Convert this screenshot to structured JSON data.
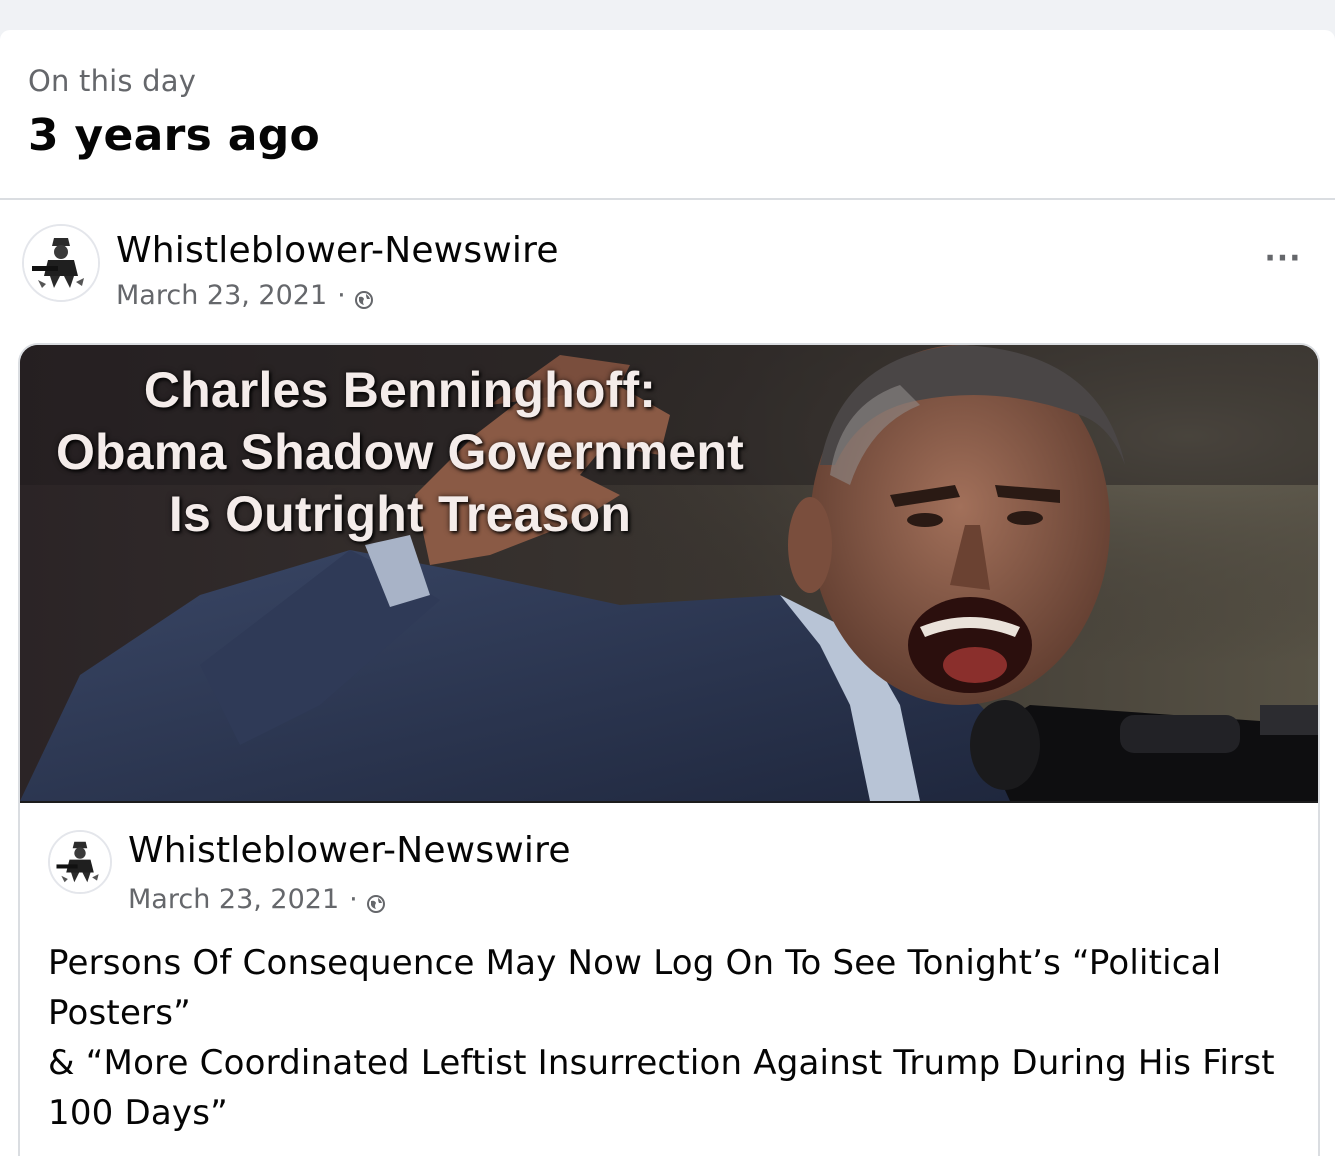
{
  "memory": {
    "kicker": "On this day",
    "title": "3 years ago"
  },
  "post": {
    "author": "Whistleblower-Newswire",
    "date": "March 23, 2021",
    "separator": "·",
    "privacy_icon": "globe-icon",
    "more_label": "···"
  },
  "shared": {
    "image": {
      "headline_lines": [
        "Charles Benninghoff:",
        "Obama Shadow Government",
        "Is Outright Treason"
      ]
    },
    "author": "Whistleblower-Newswire",
    "date": "March 23, 2021",
    "separator": "·",
    "text_lines": [
      "Persons Of Consequence May Now Log On To See Tonight’s “Political Posters”",
      "& “More Coordinated Leftist Insurrection Against Trump During His First 100 Days”"
    ]
  },
  "colors": {
    "page_bg": "#f0f2f5",
    "card_bg": "#ffffff",
    "secondary_text": "#65676b",
    "primary_text": "#050505"
  }
}
